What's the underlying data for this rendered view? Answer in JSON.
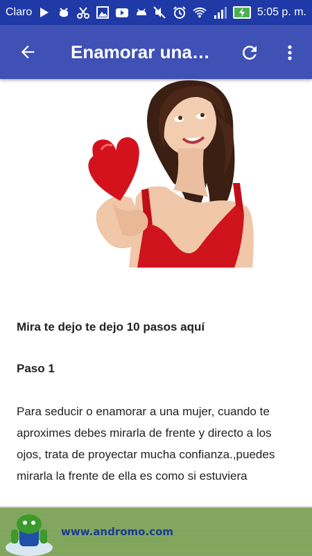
{
  "status_bar": {
    "carrier": "Claro",
    "time": "5:05 p. m.",
    "icons": [
      "play-store-icon",
      "bug-icon",
      "scissors-icon",
      "image-icon",
      "youtube-icon",
      "android-icon",
      "mute-icon",
      "alarm-icon",
      "wifi-icon",
      "signal-icon",
      "battery-charging-icon"
    ]
  },
  "app_bar": {
    "title": "Enamorar una…",
    "back_icon": "arrow-back-icon",
    "refresh_icon": "refresh-icon",
    "menu_icon": "more-vert-icon"
  },
  "content": {
    "image_alt": "woman-holding-red-heart",
    "heading1": "Mira te dejo te dejo 10 pasos aquí",
    "heading2": "Paso 1",
    "paragraph": "Para seducir o enamorar a una mujer, cuando te aproximes debes mirarla de frente y directo a los ojos, trata de proyectar mucha confianza.,puedes mirarla la frente de ella es como si estuviera"
  },
  "ad": {
    "text": "www.andromo.com"
  },
  "colors": {
    "status_bar": "#1f3aa6",
    "app_bar": "#3f51b5",
    "ad_bg": "#7fa45a",
    "ad_text": "#1b3b8f"
  }
}
